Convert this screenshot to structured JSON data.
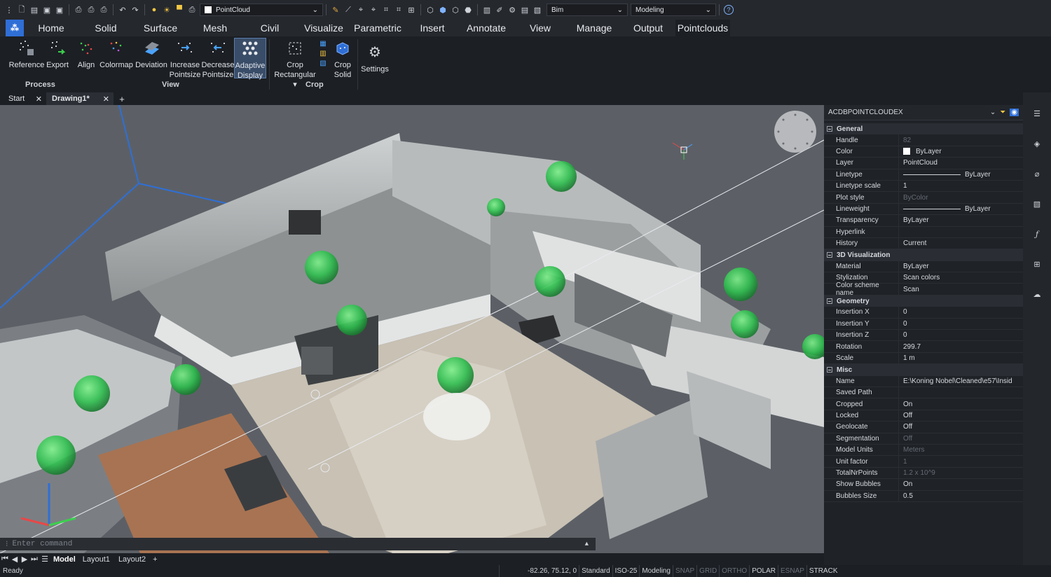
{
  "toolbar": {
    "layer": "PointCloud",
    "workspace": "Bim",
    "mode": "Modeling"
  },
  "tabs": [
    "Home",
    "Solid",
    "Surface",
    "Mesh",
    "Civil",
    "Visualize",
    "Parametric",
    "Insert",
    "Annotate",
    "View",
    "Manage",
    "Output",
    "Pointclouds"
  ],
  "ribbon": {
    "buttons": [
      {
        "l1": "Reference",
        "l2": ""
      },
      {
        "l1": "Export",
        "l2": ""
      },
      {
        "l1": "Align",
        "l2": ""
      },
      {
        "l1": "Colormap",
        "l2": ""
      },
      {
        "l1": "Deviation",
        "l2": ""
      },
      {
        "l1": "Increase",
        "l2": "Pointsize"
      },
      {
        "l1": "Decrease",
        "l2": "Pointsize"
      },
      {
        "l1": "Adaptive",
        "l2": "Display"
      },
      {
        "l1": "Crop",
        "l2": "Rectangular ▾"
      },
      {
        "l1": "Crop",
        "l2": "Solid"
      },
      {
        "l1": "Settings",
        "l2": ""
      }
    ],
    "groups": {
      "process": "Process",
      "view": "View",
      "crop": "Crop"
    }
  },
  "doc_tabs": {
    "start": "Start",
    "drawing": "Drawing1*",
    "add": "+"
  },
  "command": {
    "placeholder": "Enter command"
  },
  "layouts": [
    "Model",
    "Layout1",
    "Layout2"
  ],
  "status": {
    "ready": "Ready",
    "coords": "-82.26, 75.12, 0",
    "style": "Standard",
    "dim": "ISO-25",
    "ws": "Modeling",
    "toggles": [
      {
        "t": "SNAP",
        "on": false
      },
      {
        "t": "GRID",
        "on": false
      },
      {
        "t": "ORTHO",
        "on": false
      },
      {
        "t": "POLAR",
        "on": true
      },
      {
        "t": "ESNAP",
        "on": false
      },
      {
        "t": "STRACK",
        "on": true
      }
    ]
  },
  "panel": {
    "title": "ACDBPOINTCLOUDEX",
    "general_title": "General",
    "general": [
      {
        "k": "Handle",
        "v": "82",
        "dim": true
      },
      {
        "k": "Color",
        "v": "ByLayer",
        "swatch": true
      },
      {
        "k": "Layer",
        "v": "PointCloud"
      },
      {
        "k": "Linetype",
        "v": "ByLayer",
        "line": true
      },
      {
        "k": "Linetype scale",
        "v": "1"
      },
      {
        "k": "Plot style",
        "v": "ByColor",
        "dim": true
      },
      {
        "k": "Lineweight",
        "v": "ByLayer",
        "line": true
      },
      {
        "k": "Transparency",
        "v": "ByLayer"
      },
      {
        "k": "Hyperlink",
        "v": ""
      },
      {
        "k": "History",
        "v": "Current"
      }
    ],
    "viz_title": "3D Visualization",
    "viz": [
      {
        "k": "Material",
        "v": "ByLayer"
      },
      {
        "k": "Stylization",
        "v": "Scan colors"
      },
      {
        "k": "Color scheme name",
        "v": "Scan"
      }
    ],
    "geom_title": "Geometry",
    "geom": [
      {
        "k": "Insertion X",
        "v": "0"
      },
      {
        "k": "Insertion Y",
        "v": "0"
      },
      {
        "k": "Insertion Z",
        "v": "0"
      },
      {
        "k": "Rotation",
        "v": "299.7"
      },
      {
        "k": "Scale",
        "v": "1 m"
      }
    ],
    "misc_title": "Misc",
    "misc": [
      {
        "k": "Name",
        "v": "E:\\Koning Nobel\\Cleaned\\e57\\Insid"
      },
      {
        "k": "Saved Path",
        "v": ""
      },
      {
        "k": "Cropped",
        "v": "On"
      },
      {
        "k": "Locked",
        "v": "Off"
      },
      {
        "k": "Geolocate",
        "v": "Off"
      },
      {
        "k": "Segmentation",
        "v": "Off",
        "dim": true
      },
      {
        "k": "Model Units",
        "v": "Meters",
        "dim": true
      },
      {
        "k": "Unit factor",
        "v": "1",
        "dim": true
      },
      {
        "k": "TotalNrPoints",
        "v": "1.2 x 10^9",
        "dim": true
      },
      {
        "k": "Show Bubbles",
        "v": "On"
      },
      {
        "k": "Bubbles Size",
        "v": "0.5"
      }
    ]
  },
  "colors": {
    "accent": "#2f6fd6",
    "bubble": "#2fbf4f"
  }
}
